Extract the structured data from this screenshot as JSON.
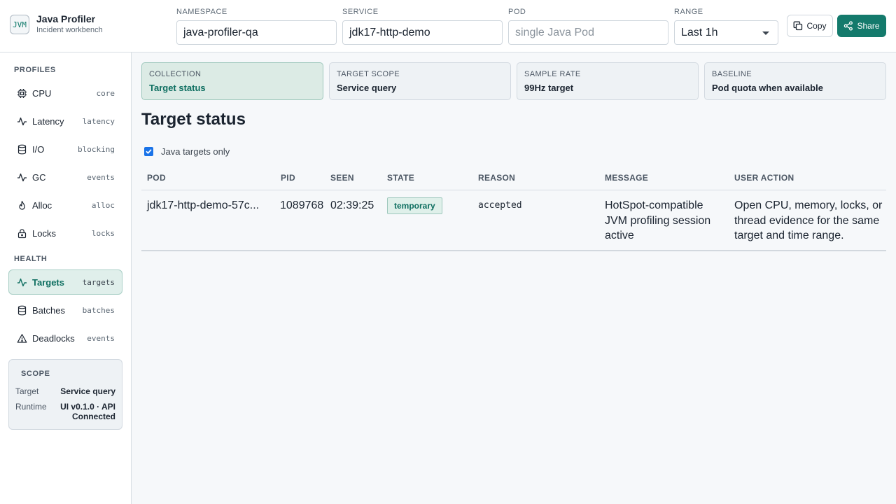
{
  "app": {
    "logo_text": "JVM",
    "title": "Java Profiler",
    "subtitle": "Incident workbench"
  },
  "filters": {
    "namespace": {
      "label": "NAMESPACE",
      "value": "java-profiler-qa"
    },
    "service": {
      "label": "SERVICE",
      "value": "jdk17-http-demo"
    },
    "pod": {
      "label": "POD",
      "value": "",
      "placeholder": "single Java Pod"
    },
    "range": {
      "label": "RANGE",
      "value": "Last 1h"
    }
  },
  "actions": {
    "copy_label": "Copy",
    "share_label": "Share"
  },
  "sidebar": {
    "profiles_title": "PROFILES",
    "profiles": [
      {
        "label": "CPU",
        "tag": "core",
        "icon": "cpu-icon"
      },
      {
        "label": "Latency",
        "tag": "latency",
        "icon": "pulse-icon"
      },
      {
        "label": "I/O",
        "tag": "blocking",
        "icon": "database-icon"
      },
      {
        "label": "GC",
        "tag": "events",
        "icon": "pulse-icon"
      },
      {
        "label": "Alloc",
        "tag": "alloc",
        "icon": "flame-icon"
      },
      {
        "label": "Locks",
        "tag": "locks",
        "icon": "lock-icon"
      }
    ],
    "health_title": "HEALTH",
    "health": [
      {
        "label": "Targets",
        "tag": "targets",
        "icon": "pulse-icon",
        "active": true
      },
      {
        "label": "Batches",
        "tag": "batches",
        "icon": "database-icon"
      },
      {
        "label": "Deadlocks",
        "tag": "events",
        "icon": "warning-icon"
      }
    ],
    "scope": {
      "title": "SCOPE",
      "target_key": "Target",
      "target_value": "Service query",
      "runtime_key": "Runtime",
      "runtime_value_line1": "UI v0.1.0 · API",
      "runtime_value_line2": "Connected"
    }
  },
  "cards": [
    {
      "label": "COLLECTION",
      "value": "Target status",
      "active": true
    },
    {
      "label": "TARGET SCOPE",
      "value": "Service query"
    },
    {
      "label": "SAMPLE RATE",
      "value": "99Hz target"
    },
    {
      "label": "BASELINE",
      "value": "Pod quota when available"
    }
  ],
  "main": {
    "title": "Target status",
    "filter_label": "Java targets only",
    "filter_checked": true
  },
  "table": {
    "headers": [
      "POD",
      "PID",
      "SEEN",
      "STATE",
      "REASON",
      "MESSAGE",
      "USER ACTION"
    ],
    "rows": [
      {
        "pod": "jdk17-http-demo-57c...",
        "pid": "1089768",
        "seen": "02:39:25",
        "state": "temporary",
        "reason": "accepted",
        "message_line1": "HotSpot-compatible",
        "message_line2": "JVM profiling session",
        "message_line3": "active",
        "action_line1": "Open CPU, memory, locks, or",
        "action_line2": "thread evidence for the same",
        "action_line3": "target and time range."
      }
    ]
  },
  "colors": {
    "accent": "#147a6c",
    "active_bg": "#e0efeb",
    "checkbox": "#1a73e8"
  }
}
